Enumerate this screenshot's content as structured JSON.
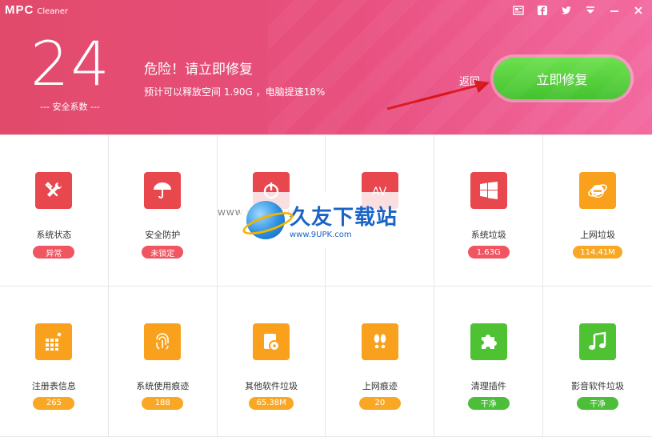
{
  "app": {
    "logo_mark": "MPC",
    "logo_word": "Cleaner"
  },
  "window_controls": [
    {
      "name": "news-icon"
    },
    {
      "name": "facebook-icon"
    },
    {
      "name": "twitter-icon"
    },
    {
      "name": "menu-icon"
    },
    {
      "name": "minimize-icon"
    },
    {
      "name": "close-icon"
    }
  ],
  "header": {
    "score": "24",
    "score_caption": "--- 安全系数 ---",
    "status_title": "危险！请立即修复",
    "status_detail": "预计可以释放空间 1.90G ，电脑提速18%",
    "back_label": "返回",
    "fix_label": "立即修复"
  },
  "tiles": [
    {
      "label": "系统状态",
      "badge": "异常",
      "icon": "tools-icon",
      "color": "#e8474d",
      "badge_class": "badge-red"
    },
    {
      "label": "安全防护",
      "badge": "未锁定",
      "icon": "umbrella-icon",
      "color": "#e8474d",
      "badge_class": "badge-red"
    },
    {
      "label": "",
      "badge": "",
      "icon": "power-icon",
      "color": "#e8474d",
      "badge_class": "badge-red"
    },
    {
      "label": "",
      "badge": "",
      "icon": "antivirus-icon",
      "color": "#e8474d",
      "badge_class": "badge-red"
    },
    {
      "label": "系统垃圾",
      "badge": "1.63G",
      "icon": "windows-icon",
      "color": "#e8474d",
      "badge_class": "badge-red"
    },
    {
      "label": "上网垃圾",
      "badge": "114.41M",
      "icon": "ie-icon",
      "color": "#f9a11d",
      "badge_class": "badge-orange"
    },
    {
      "label": "注册表信息",
      "badge": "265",
      "icon": "registry-icon",
      "color": "#f9a11d",
      "badge_class": "badge-orange"
    },
    {
      "label": "系统使用痕迹",
      "badge": "188",
      "icon": "fingerprint-icon",
      "color": "#f9a11d",
      "badge_class": "badge-orange"
    },
    {
      "label": "其他软件垃圾",
      "badge": "65.38M",
      "icon": "disc-icon",
      "color": "#f9a11d",
      "badge_class": "badge-orange"
    },
    {
      "label": "上网痕迹",
      "badge": "20",
      "icon": "footprints-icon",
      "color": "#f9a11d",
      "badge_class": "badge-orange"
    },
    {
      "label": "清理插件",
      "badge": "干净",
      "icon": "puzzle-icon",
      "color": "#4fc234",
      "badge_class": "badge-green"
    },
    {
      "label": "影音软件垃圾",
      "badge": "干净",
      "icon": "music-icon",
      "color": "#4fc234",
      "badge_class": "badge-green"
    }
  ],
  "watermark": {
    "main": "久友下载站",
    "sub": "www.9UPK.com",
    "left_url": "WWW.9UPK.COM"
  }
}
